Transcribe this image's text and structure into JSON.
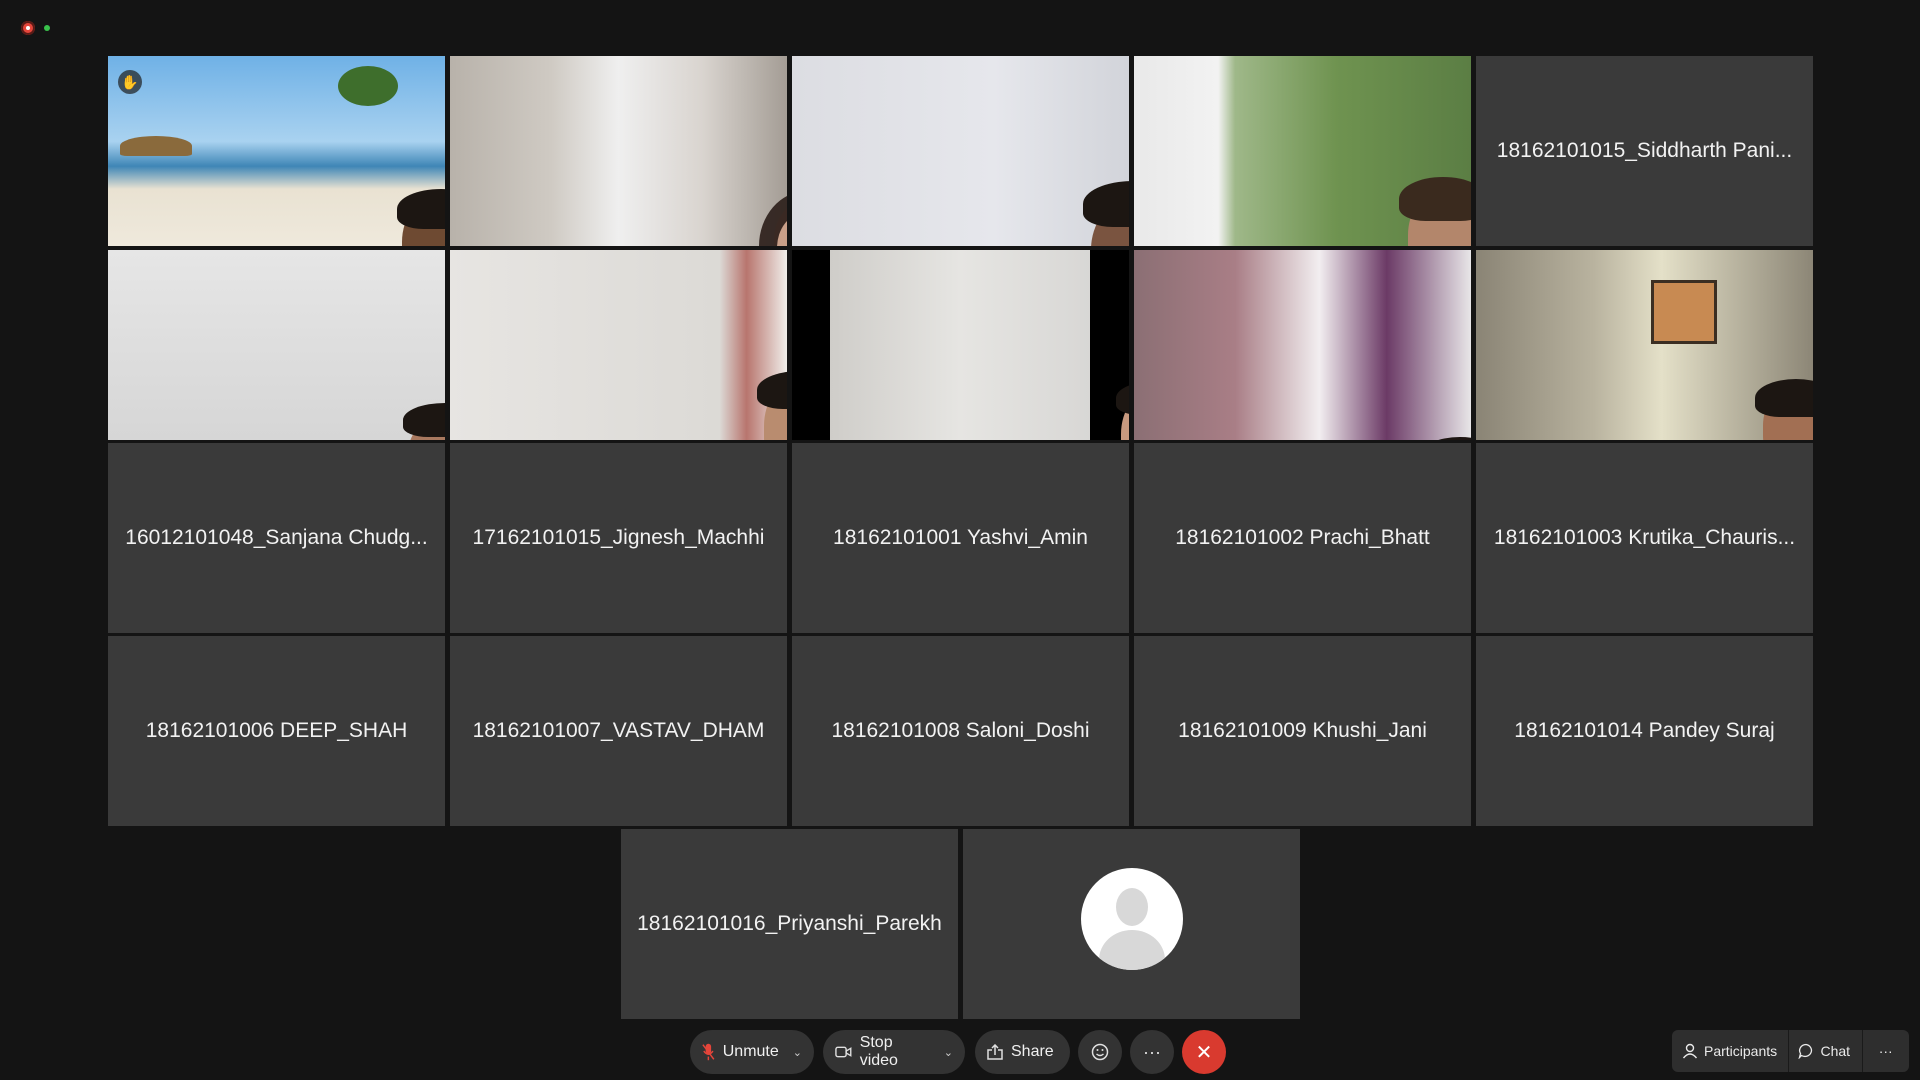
{
  "status": {
    "recording_icon": "record-icon",
    "connection_icon": "connected-dot"
  },
  "participants": [
    {
      "name": "18162101015_Siddharth Pani..."
    },
    {
      "name": "16012101048_Sanjana Chudg..."
    },
    {
      "name": "17162101015_Jignesh_Machhi"
    },
    {
      "name": "18162101001 Yashvi_Amin"
    },
    {
      "name": "18162101002 Prachi_Bhatt"
    },
    {
      "name": "18162101003 Krutika_Chauris..."
    },
    {
      "name": "18162101006 DEEP_SHAH"
    },
    {
      "name": "18162101007_VASTAV_DHAM"
    },
    {
      "name": "18162101008 Saloni_Doshi"
    },
    {
      "name": "18162101009 Khushi_Jani"
    },
    {
      "name": "18162101014 Pandey Suraj"
    },
    {
      "name": "18162101016_Priyanshi_Parekh"
    }
  ],
  "toolbar": {
    "unmute_label": "Unmute",
    "stop_video_label": "Stop video",
    "share_label": "Share",
    "participants_label": "Participants",
    "chat_label": "Chat",
    "more_glyph": "···",
    "end_glyph": "✕"
  },
  "colors": {
    "tile": "#3a3a3a",
    "background": "#141414",
    "end_call": "#d93a2f",
    "toolbar_button": "#333333"
  }
}
